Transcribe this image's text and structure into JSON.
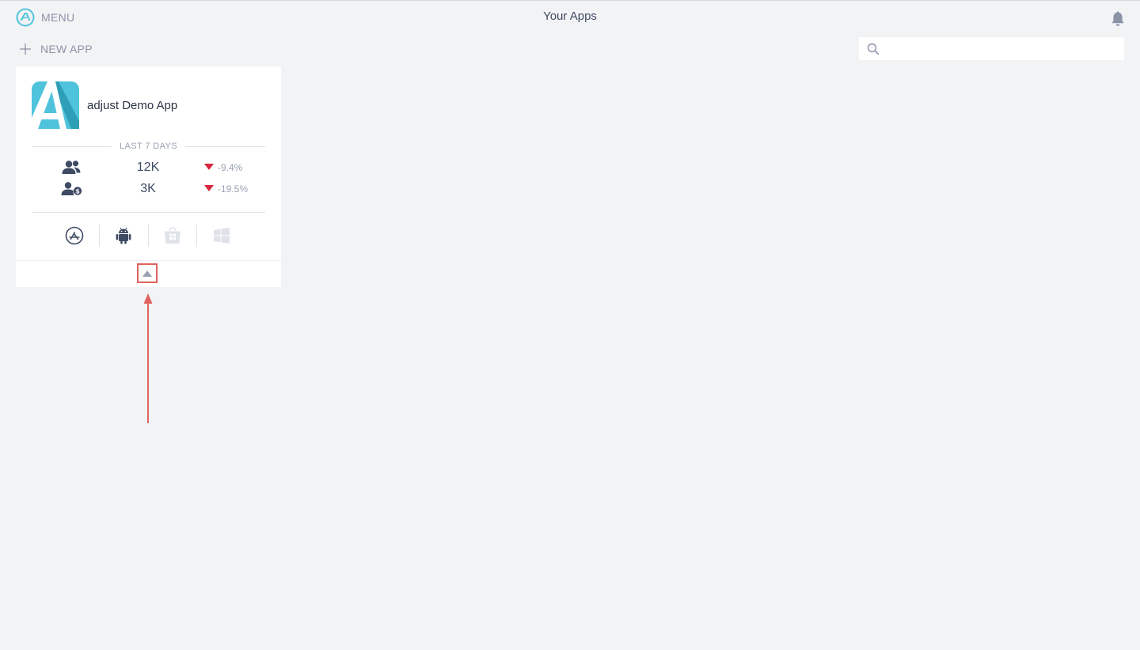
{
  "header": {
    "menu_label": "MENU",
    "page_title": "Your Apps"
  },
  "toolbar": {
    "new_app_label": "NEW APP",
    "search_value": "",
    "search_placeholder": ""
  },
  "app_card": {
    "name": "adjust Demo App",
    "period_label": "LAST 7 DAYS",
    "metrics": [
      {
        "icon": "users-icon",
        "value": "12K",
        "change": "-9.4%",
        "trend": "down"
      },
      {
        "icon": "paying-users-icon",
        "value": "3K",
        "change": "-19.5%",
        "trend": "down"
      }
    ],
    "platforms": [
      {
        "icon": "app-store-icon",
        "active": true
      },
      {
        "icon": "android-icon",
        "active": true
      },
      {
        "icon": "windows-store-icon",
        "active": false
      },
      {
        "icon": "windows-icon",
        "active": false
      }
    ]
  },
  "colors": {
    "accent": "#4fc3dc",
    "negative": "#d7283f",
    "annotation": "#e0625e",
    "icon_active": "#3f4a63",
    "icon_inactive": "#dfe2e8"
  }
}
